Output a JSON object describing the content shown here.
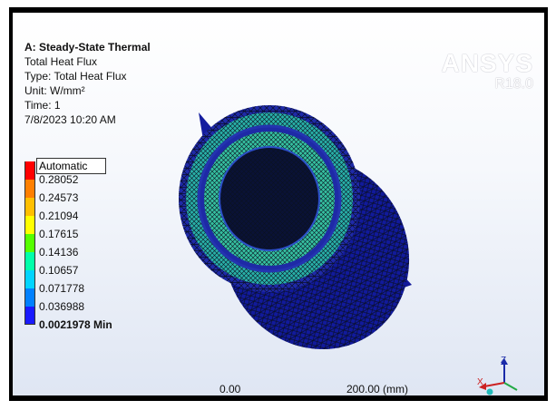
{
  "header": {
    "title": "A: Steady-State Thermal",
    "line1": "Total Heat Flux",
    "line2": "Type: Total Heat Flux",
    "line3": "Unit: W/mm²",
    "line4": "Time: 1",
    "line5": "7/8/2023 10:20 AM"
  },
  "brand": {
    "name": "ANSYS",
    "version": "R18.0"
  },
  "legend": {
    "title": "Automatic",
    "labels": [
      "0.28052",
      "0.24573",
      "0.21094",
      "0.17615",
      "0.14136",
      "0.10657",
      "0.071778",
      "0.036988",
      "0.0021978 Min"
    ],
    "colors": [
      "#ff0000",
      "#ff7f00",
      "#ffbf00",
      "#ffff00",
      "#55ff00",
      "#00ffaa",
      "#00d4ff",
      "#0080ff",
      "#1a1aff"
    ]
  },
  "scale_bar": {
    "left": "0.00",
    "right": "200.00 (mm)"
  },
  "triad": {
    "z": "Z",
    "x": "X"
  }
}
